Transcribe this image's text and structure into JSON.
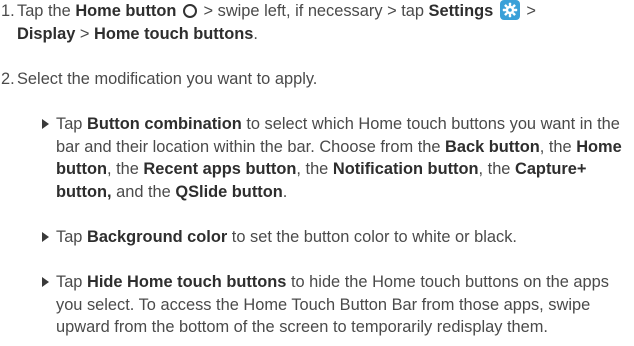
{
  "step1": {
    "number": "1.",
    "t1": "Tap the ",
    "home_button": "Home button",
    "t2": " > swipe left, if necessary > tap ",
    "settings": "Settings",
    "t3": " >",
    "display": "Display",
    "t4": " > ",
    "home_touch_buttons": "Home touch buttons",
    "t5": "."
  },
  "step2": {
    "number": "2.",
    "text": "Select the modification you want to apply."
  },
  "bullet1": {
    "t1": "Tap ",
    "button_combination": "Button combination",
    "t2": " to select which Home touch buttons you want in the bar and their location within the bar. Choose from the ",
    "back_button": "Back button",
    "t3": ", the ",
    "home_button": "Home button",
    "t4": ", the ",
    "recent_apps_button": "Recent apps button",
    "t5": ", the ",
    "notification_button": "Notification button",
    "t6": ", the ",
    "capture_button": "Capture+ button,",
    "t7": " and the ",
    "qslide_button": "QSlide button",
    "t8": "."
  },
  "bullet2": {
    "t1": "Tap ",
    "background_color": "Background color",
    "t2": " to set the button color to white or black."
  },
  "bullet3": {
    "t1": "Tap ",
    "hide_home_touch_buttons": "Hide Home touch buttons",
    "t2": " to hide the Home touch buttons on the apps you select. To access the Home Touch Button Bar from those apps, swipe upward from the bottom of the screen to temporarily redisplay them."
  },
  "icons": {
    "home": "home-circle-icon",
    "settings": "settings-gear-icon",
    "bullet": "triangle-bullet-icon",
    "settings_color": "#3aa0d8"
  }
}
